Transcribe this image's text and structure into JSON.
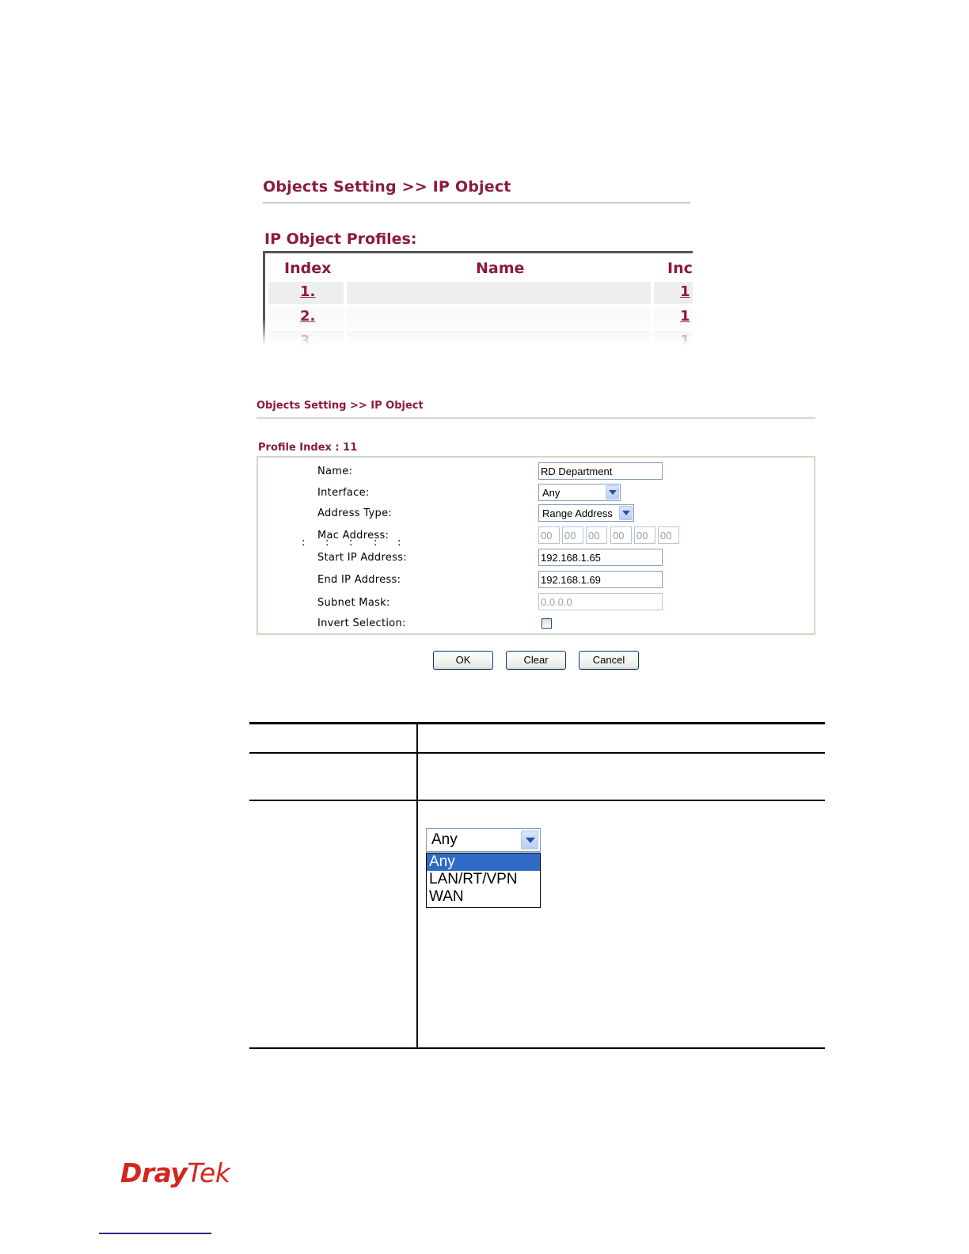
{
  "profile_list": {
    "breadcrumb": "Objects Setting >> IP Object",
    "subtitle": "IP Object Profiles:",
    "columns": [
      "Index",
      "Name",
      "Inc"
    ],
    "rows": [
      {
        "index": "1.",
        "name": "",
        "third": "1"
      },
      {
        "index": "2.",
        "name": "",
        "third": "1"
      },
      {
        "index": "3.",
        "name": "",
        "third": "1"
      }
    ]
  },
  "edit_form": {
    "breadcrumb": "Objects Setting >> IP Object",
    "profile_index": "Profile Index : 11",
    "labels": {
      "name": "Name:",
      "interface": "Interface:",
      "address_type": "Address Type:",
      "mac_address": "Mac Address:",
      "start_ip": "Start IP Address:",
      "end_ip": "End IP Address:",
      "subnet_mask": "Subnet Mask:",
      "invert": "Invert Selection:"
    },
    "values": {
      "name": "RD Department",
      "interface": "Any",
      "address_type": "Range Address",
      "mac": [
        "00",
        "00",
        "00",
        "00",
        "00",
        "00"
      ],
      "start_ip": "192.168.1.65",
      "end_ip": "192.168.1.69",
      "subnet_mask": "0.0.0.0",
      "invert_checked": false
    },
    "buttons": {
      "ok": "OK",
      "clear": "Clear",
      "cancel": "Cancel"
    }
  },
  "interface_dropdown": {
    "selected": "Any",
    "options": [
      "Any",
      "LAN/RT/VPN",
      "WAN"
    ],
    "highlighted": "Any"
  },
  "footer": {
    "logo_dray": "Dray",
    "logo_tek": "Tek"
  },
  "colors": {
    "heading": "#8b1a3f",
    "logo": "#d4261e",
    "highlight": "#3169c6"
  }
}
